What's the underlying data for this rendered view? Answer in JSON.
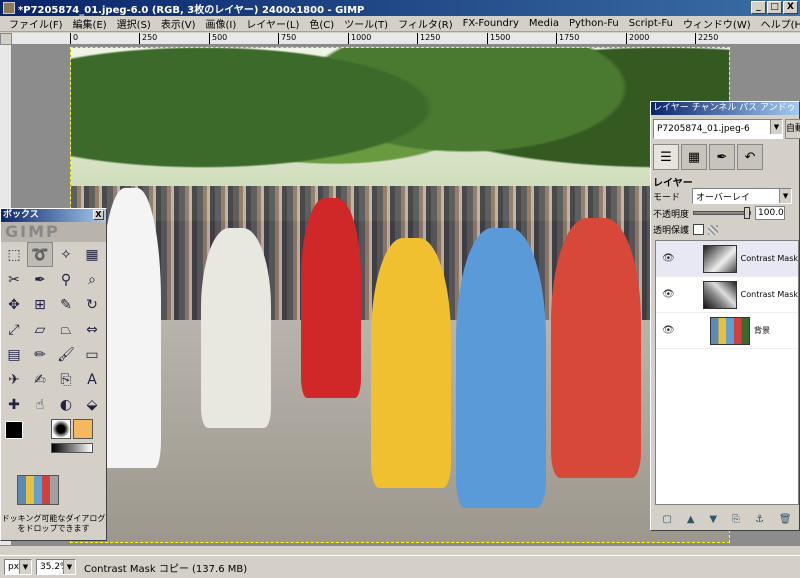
{
  "window": {
    "title": "*P7205874_01.jpeg-6.0 (RGB, 3枚のレイヤー) 2400x1800 - GIMP",
    "controls": {
      "minimize": "_",
      "maximize": "□",
      "close": "X"
    }
  },
  "menu": [
    "ファイル(F)",
    "編集(E)",
    "選択(S)",
    "表示(V)",
    "画像(I)",
    "レイヤー(L)",
    "色(C)",
    "ツール(T)",
    "フィルタ(R)",
    "FX-Foundry",
    "Media",
    "Python-Fu",
    "Script-Fu",
    "ウィンドウ(W)",
    "ヘルプ(H)"
  ],
  "ruler": {
    "ticks": [
      "0",
      "250",
      "500",
      "750",
      "1000",
      "1250",
      "1500",
      "1750",
      "2000",
      "2250"
    ]
  },
  "toolbox": {
    "title": "ボックス",
    "close": "X",
    "logo": "GIMP",
    "hint": "ドッキング可能なダイアログをドロップできます",
    "tools": [
      "rect-select",
      "free-select",
      "fuzzy-select",
      "color-select",
      "scissors",
      "paths",
      "color-picker",
      "zoom",
      "move",
      "align",
      "crop",
      "rotate",
      "scale",
      "shear",
      "perspective",
      "flip",
      "text",
      "bucket-fill",
      "blend",
      "pencil",
      "paintbrush",
      "eraser",
      "airbrush",
      "ink",
      "clone",
      "heal",
      "perspective-clone",
      "blur",
      "smudge",
      "dodge-burn"
    ],
    "text_tool_glyph": "A"
  },
  "dock": {
    "title": "レイヤー チャンネル パス アンドゥ",
    "image_combo": "P7205874_01.jpeg-6",
    "auto_button": "自動",
    "heading": "レイヤー",
    "mode_label": "モード",
    "mode_value": "オーバーレイ",
    "opacity_label": "不透明度",
    "opacity_value": "100.0",
    "opacity_fraction": 1.0,
    "lock_label": "透明保護",
    "layers": [
      {
        "name": "Contrast Mask",
        "type": "mask1"
      },
      {
        "name": "Contrast Mask",
        "type": "mask2"
      },
      {
        "name": "背景",
        "type": "bg"
      }
    ]
  },
  "status": {
    "unit": "px",
    "zoom": "35.2%",
    "message": "Contrast Mask コピー (137.6 MB)"
  }
}
